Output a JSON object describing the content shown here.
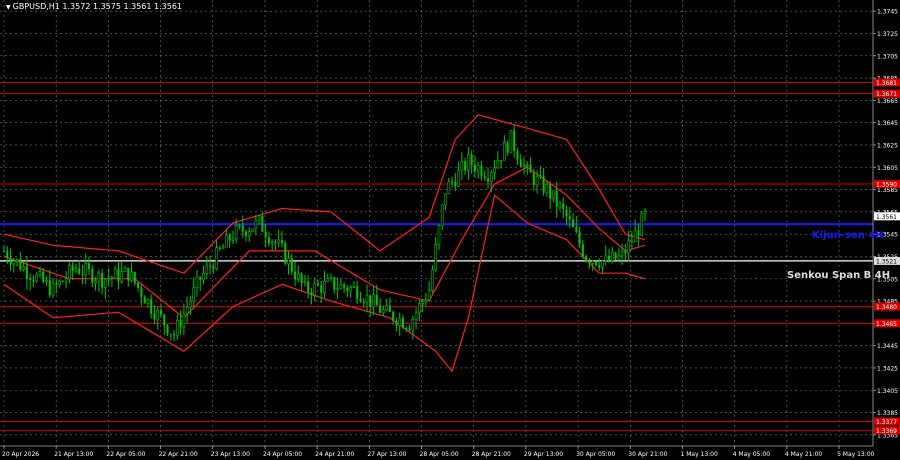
{
  "window": {
    "symbol_line": "GBPUSD,H1  1.3572 1.3575 1.3561 1.3561"
  },
  "colors": {
    "background": "#000000",
    "grid": "#7a7a7a",
    "bull": "#00c800",
    "bear": "#00c800",
    "resistance": "#d40000",
    "ichimoku": "#ff2020",
    "kijun": "#1a1aff",
    "senkou": "#ffffff",
    "axis_text": "#ffffff"
  },
  "chart_data": {
    "type": "candlestick",
    "title": "GBPUSD,H1",
    "ylim": [
      1.3355,
      1.3755
    ],
    "y_ticks": [
      "1.3745",
      "1.3725",
      "1.3705",
      "1.3685",
      "1.3665",
      "1.3645",
      "1.3625",
      "1.3605",
      "1.3585",
      "1.3565",
      "1.3545",
      "1.3525",
      "1.3505",
      "1.3485",
      "1.3465",
      "1.3445",
      "1.3425",
      "1.3405",
      "1.3385",
      "1.3365"
    ],
    "x_ticks": [
      "20 Apr 2026",
      "21 Apr 13:00",
      "22 Apr 05:00",
      "22 Apr 21:00",
      "23 Apr 13:00",
      "24 Apr 05:00",
      "24 Apr 21:00",
      "27 Apr 13:00",
      "28 Apr 05:00",
      "28 Apr 21:00",
      "29 Apr 13:00",
      "30 Apr 05:00",
      "30 Apr 21:00",
      "1 May 13:00",
      "4 May 05:00",
      "4 May 21:00",
      "5 May 13:00"
    ],
    "horizontal_levels": [
      {
        "value": 1.3681,
        "label": "1.3681",
        "kind": "resistance"
      },
      {
        "value": 1.3671,
        "label": "1.3671",
        "kind": "resistance"
      },
      {
        "value": 1.359,
        "label": "1.3590",
        "kind": "resistance"
      },
      {
        "value": 1.3554,
        "label": "Kijun-sen 4H",
        "kind": "kijun"
      },
      {
        "value": 1.3521,
        "label": "Senkou Span B 4H",
        "kind": "senkou"
      },
      {
        "value": 1.348,
        "label": "1.3480",
        "kind": "resistance"
      },
      {
        "value": 1.3465,
        "label": "1.3465",
        "kind": "resistance"
      },
      {
        "value": 1.3377,
        "label": "1.3377",
        "kind": "resistance"
      },
      {
        "value": 1.3369,
        "label": "1.3369",
        "kind": "resistance"
      }
    ],
    "price_labels": [
      {
        "value": 1.3561,
        "label": "1.3561",
        "style": "current"
      },
      {
        "value": 1.3521,
        "label": "1.3521",
        "style": "senkou"
      }
    ],
    "close_path": [
      {
        "i": 0,
        "c": 1.353
      },
      {
        "i": 8,
        "c": 1.351
      },
      {
        "i": 15,
        "c": 1.3495
      },
      {
        "i": 22,
        "c": 1.3515
      },
      {
        "i": 30,
        "c": 1.3505
      },
      {
        "i": 38,
        "c": 1.351
      },
      {
        "i": 45,
        "c": 1.348
      },
      {
        "i": 52,
        "c": 1.3455
      },
      {
        "i": 60,
        "c": 1.3505
      },
      {
        "i": 70,
        "c": 1.3545
      },
      {
        "i": 78,
        "c": 1.3555
      },
      {
        "i": 85,
        "c": 1.353
      },
      {
        "i": 92,
        "c": 1.3495
      },
      {
        "i": 100,
        "c": 1.35
      },
      {
        "i": 108,
        "c": 1.3495
      },
      {
        "i": 116,
        "c": 1.3475
      },
      {
        "i": 124,
        "c": 1.3465
      },
      {
        "i": 130,
        "c": 1.3495
      },
      {
        "i": 135,
        "c": 1.3585
      },
      {
        "i": 142,
        "c": 1.361
      },
      {
        "i": 148,
        "c": 1.36
      },
      {
        "i": 155,
        "c": 1.363
      },
      {
        "i": 160,
        "c": 1.36
      },
      {
        "i": 166,
        "c": 1.3585
      },
      {
        "i": 172,
        "c": 1.356
      },
      {
        "i": 178,
        "c": 1.3525
      },
      {
        "i": 184,
        "c": 1.352
      },
      {
        "i": 189,
        "c": 1.3525
      },
      {
        "i": 193,
        "c": 1.3545
      },
      {
        "i": 196,
        "c": 1.3561
      }
    ],
    "ichimoku_upper": [
      {
        "i": 0,
        "v": 1.3545
      },
      {
        "i": 15,
        "v": 1.3535
      },
      {
        "i": 35,
        "v": 1.353
      },
      {
        "i": 55,
        "v": 1.351
      },
      {
        "i": 70,
        "v": 1.3555
      },
      {
        "i": 85,
        "v": 1.3568
      },
      {
        "i": 100,
        "v": 1.3565
      },
      {
        "i": 115,
        "v": 1.353
      },
      {
        "i": 130,
        "v": 1.356
      },
      {
        "i": 138,
        "v": 1.363
      },
      {
        "i": 145,
        "v": 1.3652
      },
      {
        "i": 160,
        "v": 1.364
      },
      {
        "i": 172,
        "v": 1.363
      },
      {
        "i": 182,
        "v": 1.3585
      },
      {
        "i": 190,
        "v": 1.3545
      },
      {
        "i": 196,
        "v": 1.354
      }
    ],
    "ichimoku_lower": [
      {
        "i": 0,
        "v": 1.35
      },
      {
        "i": 15,
        "v": 1.347
      },
      {
        "i": 35,
        "v": 1.3475
      },
      {
        "i": 55,
        "v": 1.344
      },
      {
        "i": 70,
        "v": 1.348
      },
      {
        "i": 85,
        "v": 1.35
      },
      {
        "i": 100,
        "v": 1.3485
      },
      {
        "i": 118,
        "v": 1.347
      },
      {
        "i": 132,
        "v": 1.344
      },
      {
        "i": 137,
        "v": 1.3422
      },
      {
        "i": 142,
        "v": 1.347
      },
      {
        "i": 150,
        "v": 1.358
      },
      {
        "i": 160,
        "v": 1.3555
      },
      {
        "i": 172,
        "v": 1.354
      },
      {
        "i": 182,
        "v": 1.351
      },
      {
        "i": 190,
        "v": 1.351
      },
      {
        "i": 196,
        "v": 1.3505
      }
    ],
    "ichimoku_mid": [
      {
        "i": 0,
        "v": 1.3525
      },
      {
        "i": 20,
        "v": 1.3505
      },
      {
        "i": 40,
        "v": 1.3505
      },
      {
        "i": 55,
        "v": 1.347
      },
      {
        "i": 75,
        "v": 1.353
      },
      {
        "i": 95,
        "v": 1.353
      },
      {
        "i": 115,
        "v": 1.3495
      },
      {
        "i": 130,
        "v": 1.3485
      },
      {
        "i": 140,
        "v": 1.354
      },
      {
        "i": 150,
        "v": 1.359
      },
      {
        "i": 160,
        "v": 1.3605
      },
      {
        "i": 172,
        "v": 1.358
      },
      {
        "i": 182,
        "v": 1.355
      },
      {
        "i": 190,
        "v": 1.353
      },
      {
        "i": 196,
        "v": 1.3535
      }
    ],
    "n_candles": 197,
    "grid": true
  }
}
